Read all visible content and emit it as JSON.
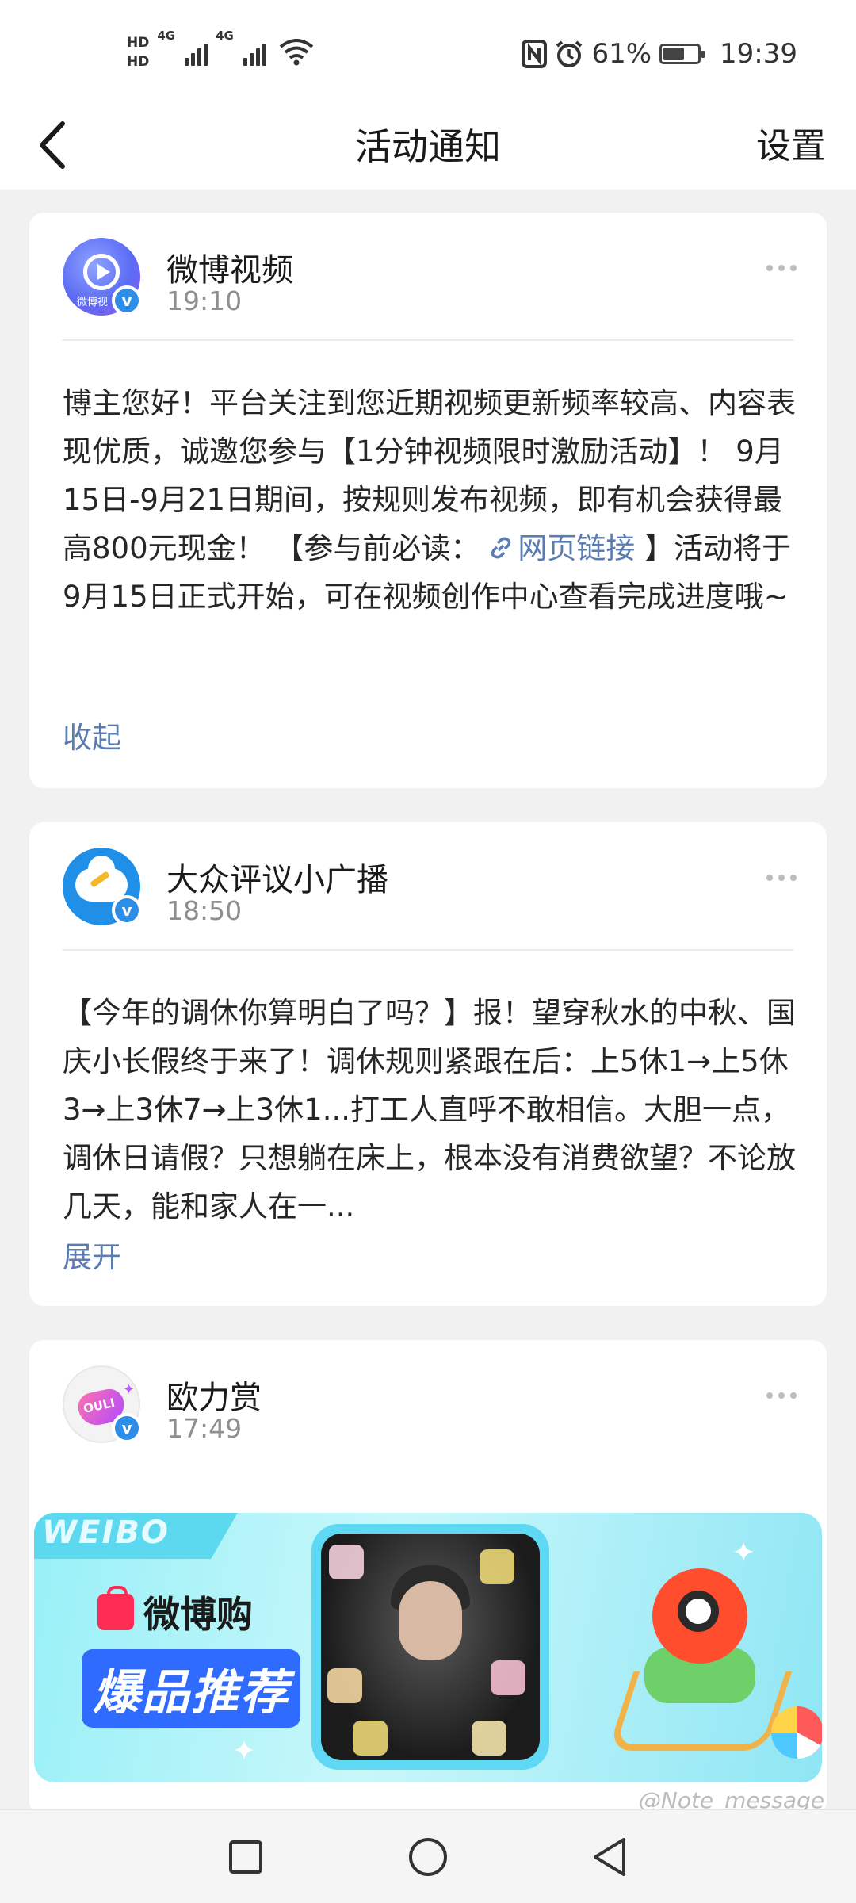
{
  "status_bar": {
    "hd1": "HD",
    "hd2": "HD",
    "net1": "4G",
    "net2": "4G",
    "battery_text": "61%",
    "battery_level": 0.61,
    "time": "19:39",
    "icons": [
      "hd-icon",
      "signal-icon",
      "wifi-icon",
      "nfc-icon",
      "alarm-icon",
      "battery-icon"
    ]
  },
  "header": {
    "title": "活动通知",
    "settings": "设置",
    "back_icon": "chevron-left-icon"
  },
  "notifications": [
    {
      "sender": "微博视频",
      "avatar_text": "微博视",
      "time": "19:10",
      "body_before_link": "博主您好！平台关注到您近期视频更新频率较高、内容表现优质，诚邀您参与【1分钟视频限时激励活动】！ 9月15日-9月21日期间，按规则发布视频，即有机会获得最高800元现金！ 【参与前必读：",
      "link_text": "网页链接",
      "body_after_link": " 】活动将于9月15日正式开始，可在视频创作中心查看完成进度哦~",
      "toggle": "收起"
    },
    {
      "sender": "大众评议小广播",
      "time": "18:50",
      "body": "【今年的调休你算明白了吗？】报！望穿秋水的中秋、国庆小长假终于来了！调休规则紧跟在后：上5休1→上5休3→上3休7→上3休1...打工人直呼不敢相信。大胆一点，调休日请假？只想躺在床上，根本没有消费欲望？不论放几天，能和家人在一...",
      "toggle": "展开"
    },
    {
      "sender": "欧力赏",
      "avatar_text": "OULI",
      "time": "17:49",
      "banner": {
        "strip_text": "WEIBO",
        "shop_name": "微博购",
        "promo": "爆品推荐"
      }
    }
  ],
  "watermark": "@Note_message",
  "nav": {
    "icons": [
      "recent-apps-icon",
      "home-icon",
      "back-icon"
    ]
  },
  "colors": {
    "accent_link": "#5a7cb0",
    "verified_badge": "#2e8de6",
    "background": "#f1f1f1"
  }
}
